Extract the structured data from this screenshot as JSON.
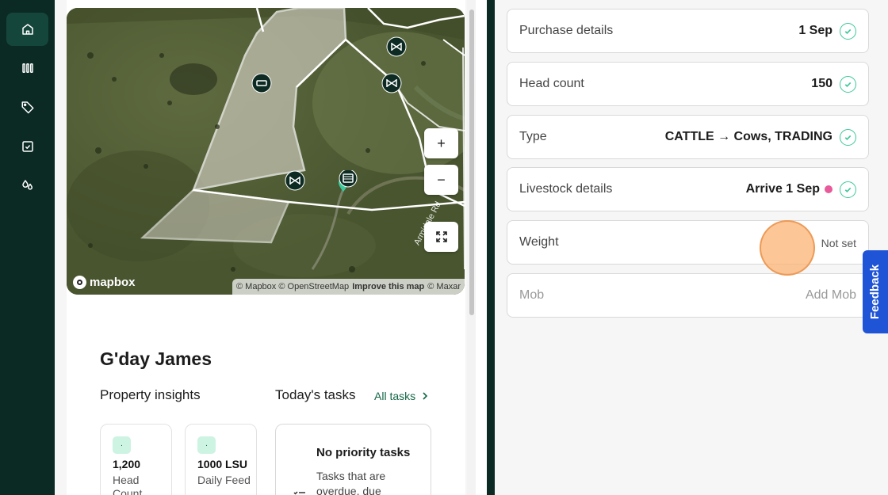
{
  "sidebar": {
    "items": [
      {
        "icon": "home-icon",
        "active": true
      },
      {
        "icon": "paddocks-icon",
        "active": false
      },
      {
        "icon": "tag-icon",
        "active": false
      },
      {
        "icon": "checkbox-icon",
        "active": false
      },
      {
        "icon": "drops-icon",
        "active": false
      }
    ]
  },
  "map": {
    "zoom_in": "+",
    "zoom_out": "−",
    "logo": "mapbox",
    "attribution": {
      "mapbox": "© Mapbox",
      "osm": "© OpenStreetMap",
      "improve": "Improve this map",
      "maxar": "© Maxar"
    },
    "road_label": "Armidale Rd"
  },
  "dashboard": {
    "greeting": "G'day James",
    "insights_title": "Property insights",
    "tasks_title": "Today's tasks",
    "all_tasks_link": "All tasks",
    "insights": [
      {
        "badge": "·",
        "value": "1,200",
        "label": "Head Count"
      },
      {
        "badge": "·",
        "value": "1000  LSU",
        "label": "Daily Feed"
      }
    ],
    "tasks_card": {
      "title": "No priority tasks",
      "text": "Tasks that are overdue, due"
    }
  },
  "details": {
    "rows": [
      {
        "label": "Purchase details",
        "value": "1 Sep",
        "checked": true
      },
      {
        "label": "Head count",
        "value": "150",
        "checked": true
      },
      {
        "label": "Type",
        "value": "CATTLE → Cows, TRADING",
        "checked": true
      },
      {
        "label": "Livestock details",
        "value": "Arrive 1 Sep",
        "checked": true
      },
      {
        "label": "Weight",
        "value": "Not set",
        "checked": false
      },
      {
        "label": "Mob",
        "value": "Add Mob",
        "checked": false
      }
    ]
  },
  "feedback": {
    "label": "Feedback"
  },
  "colors": {
    "sidebar_bg": "#0b2a24",
    "accent": "#136646",
    "check": "#3cc89a",
    "feedback": "#1f54d7"
  }
}
